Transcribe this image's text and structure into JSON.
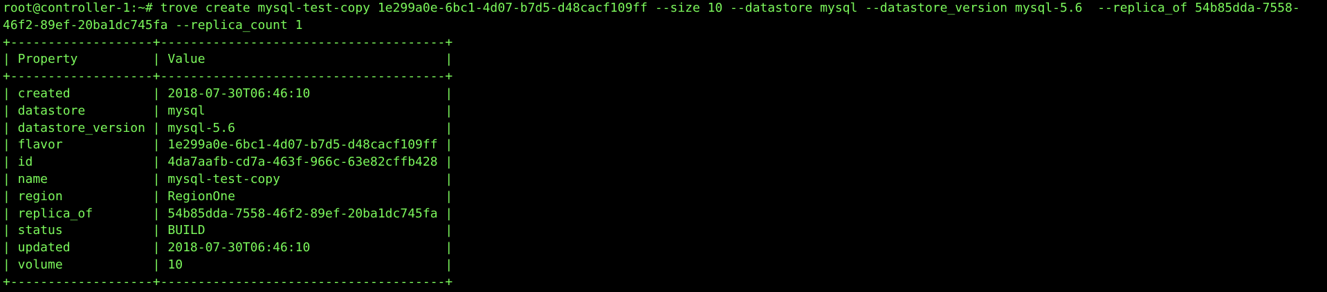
{
  "terminal": {
    "prompt": "root@controller-1:~#",
    "command_line_1": "root@controller-1:~# trove create mysql-test-copy 1e299a0e-6bc1-4d07-b7d5-d48cacf109ff --size 10 --datastore mysql --datastore_version mysql-5.6  --replica_of 54b85dda-7558-",
    "command_line_2": "46f2-89ef-20ba1dc745fa --replica_count 1",
    "table": {
      "border": "+-------------------+--------------------------------------+",
      "header": "| Property          | Value                                |",
      "rows": [
        "| created           | 2018-07-30T06:46:10                  |",
        "| datastore         | mysql                                |",
        "| datastore_version | mysql-5.6                            |",
        "| flavor            | 1e299a0e-6bc1-4d07-b7d5-d48cacf109ff |",
        "| id                | 4da7aafb-cd7a-463f-966c-63e82cffb428 |",
        "| name              | mysql-test-copy                      |",
        "| region            | RegionOne                            |",
        "| replica_of        | 54b85dda-7558-46f2-89ef-20ba1dc745fa |",
        "| status            | BUILD                                |",
        "| updated           | 2018-07-30T06:46:10                  |",
        "| volume            | 10                                   |"
      ]
    },
    "colors": {
      "background": "#000000",
      "foreground": "#7cf85c"
    }
  }
}
